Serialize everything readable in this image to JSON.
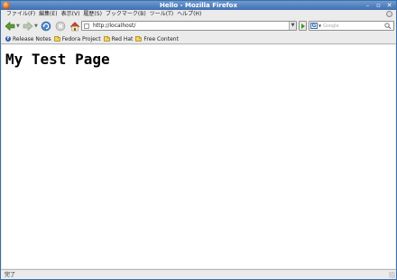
{
  "window": {
    "title": "Hello - Mozilla Firefox",
    "controls": [
      "–",
      "▫",
      "✕"
    ]
  },
  "menu": {
    "items": [
      "ファイル(F)",
      "編集(E)",
      "表示(V)",
      "履歴(S)",
      "ブックマーク(B)",
      "ツール(T)",
      "ヘルプ(H)"
    ]
  },
  "navigation": {
    "url": "http://localhost/",
    "search_placeholder": "Google",
    "search_engine_letter": "G"
  },
  "bookmarks": [
    {
      "label": "Release Notes",
      "icon": "fedora-icon"
    },
    {
      "label": "Fedora Project",
      "icon": "folder-icon"
    },
    {
      "label": "Red Hat",
      "icon": "folder-icon"
    },
    {
      "label": "Free Content",
      "icon": "folder-icon"
    }
  ],
  "page": {
    "heading": "My Test Page"
  },
  "status": {
    "text": "完了"
  },
  "colors": {
    "titlebar": "#3f6fb0",
    "chrome": "#ebebeb",
    "go_arrow": "#3a9a1c"
  }
}
